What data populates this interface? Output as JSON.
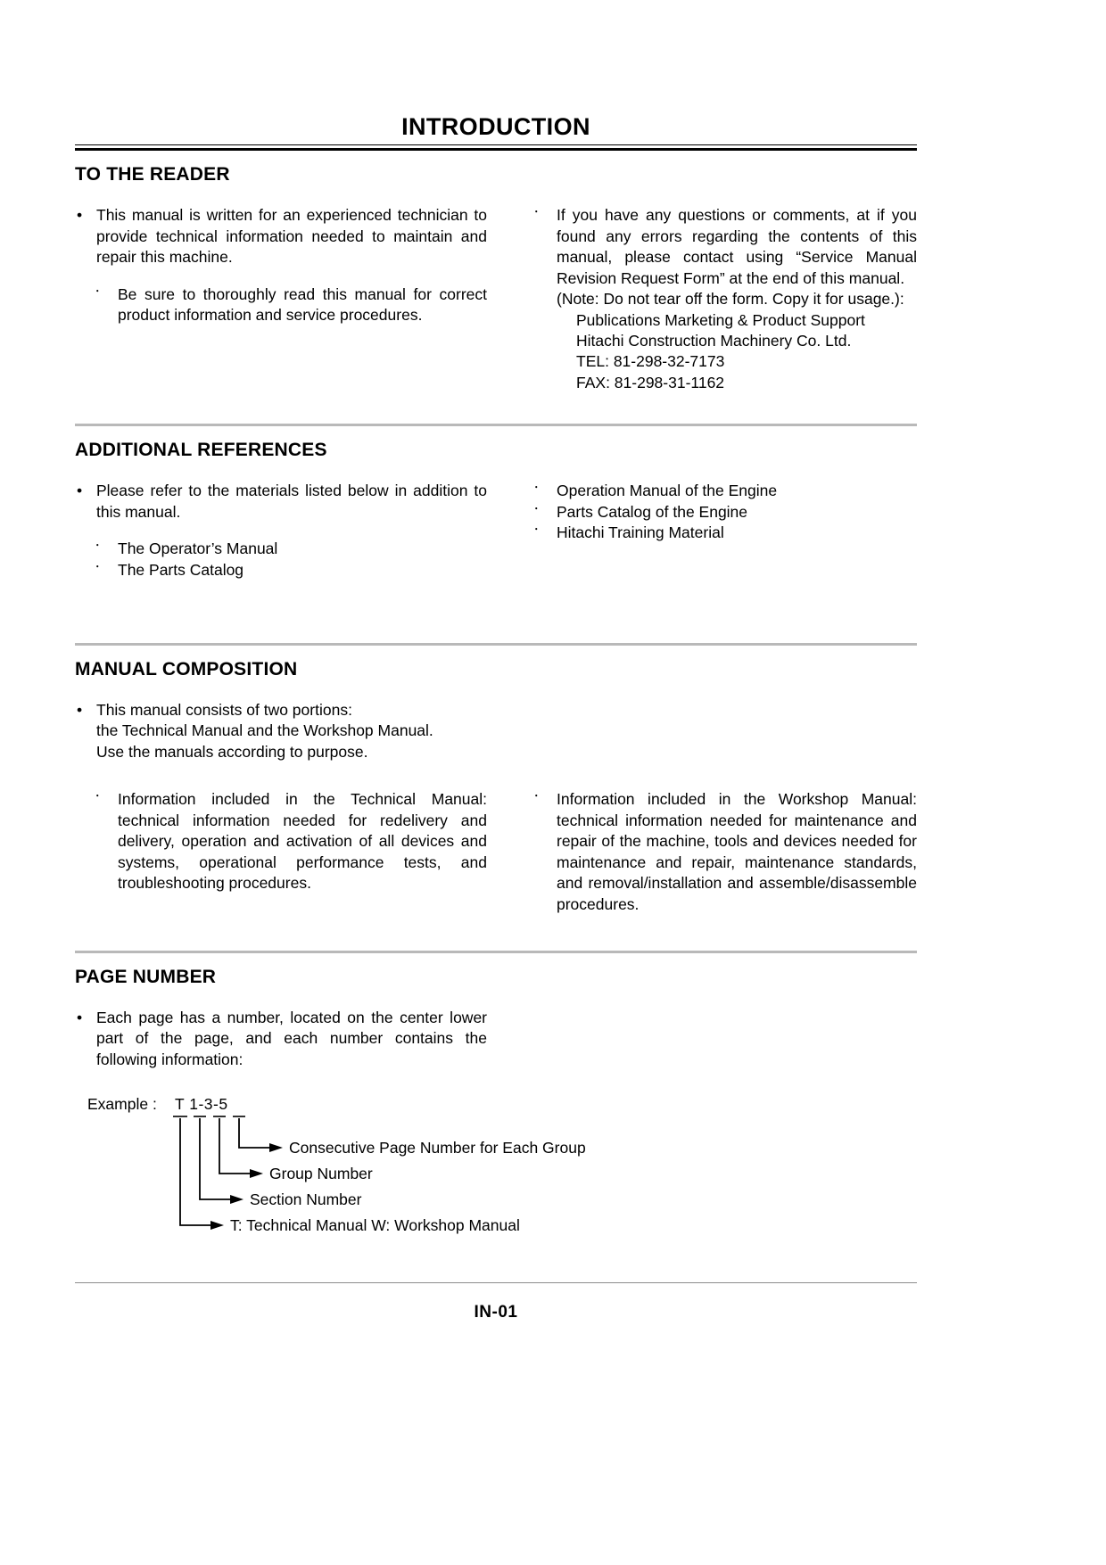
{
  "document": {
    "title": "INTRODUCTION",
    "page_number": "IN-01"
  },
  "sections": {
    "to_the_reader": {
      "heading": "TO THE READER",
      "left": {
        "bullet_1": "This manual is written for an experienced technician to provide technical information needed to maintain and repair this machine.",
        "sub_1": "Be sure to thoroughly read this manual for correct product information and service procedures."
      },
      "right": {
        "sub_1": "If you have any questions or comments, at if you found any errors regarding the contents of this manual, please contact using “Service Manual Revision Request Form” at the end of this manual.",
        "note": "(Note: Do not tear off the form. Copy it for usage.):",
        "address_1": "Publications Marketing & Product Support",
        "address_2": "Hitachi Construction Machinery Co. Ltd.",
        "tel": "TEL: 81-298-32-7173",
        "fax": "FAX: 81-298-31-1162"
      }
    },
    "additional_references": {
      "heading": "ADDITIONAL REFERENCES",
      "left": {
        "bullet_1": "Please refer to the materials listed below in addition to this manual.",
        "sub_1": "The Operator’s Manual",
        "sub_2": "The Parts Catalog"
      },
      "right": {
        "item_1": "Operation Manual of the Engine",
        "item_2": "Parts Catalog of the Engine",
        "item_3": "Hitachi Training Material"
      }
    },
    "manual_composition": {
      "heading": "MANUAL COMPOSITION",
      "left": {
        "bullet_line_1": "This manual consists of two portions:",
        "bullet_line_2": "the Technical Manual and the Workshop Manual.",
        "bullet_line_3": "Use the manuals according to purpose.",
        "sub_1": "Information included in the Technical Manual: technical information needed for redelivery and delivery, operation and activation of all devices and systems, operational performance tests, and troubleshooting procedures."
      },
      "right": {
        "sub_1": "Information included in the Workshop Manual: technical information needed for maintenance and repair of the machine, tools and devices needed for maintenance and repair, maintenance standards, and removal/installation and assemble/disassemble procedures."
      }
    },
    "page_number": {
      "heading": "PAGE NUMBER",
      "bullet_1": "Each page has a number, located on the center lower part of the page, and each number contains the following information:",
      "example_label": "Example :",
      "example_code": "T 1-3-5",
      "callouts": {
        "callout_1": "Consecutive Page Number for Each Group",
        "callout_2": "Group Number",
        "callout_3": "Section Number",
        "callout_4": "T: Technical Manual     W: Workshop Manual"
      }
    }
  },
  "markers": {
    "bullet_dot": "•",
    "sub_dot": "･"
  },
  "colors": {
    "text": "#000000",
    "divider": "#b9b9b9",
    "rule": "#000000",
    "footer_rule": "#8c8c8c"
  }
}
